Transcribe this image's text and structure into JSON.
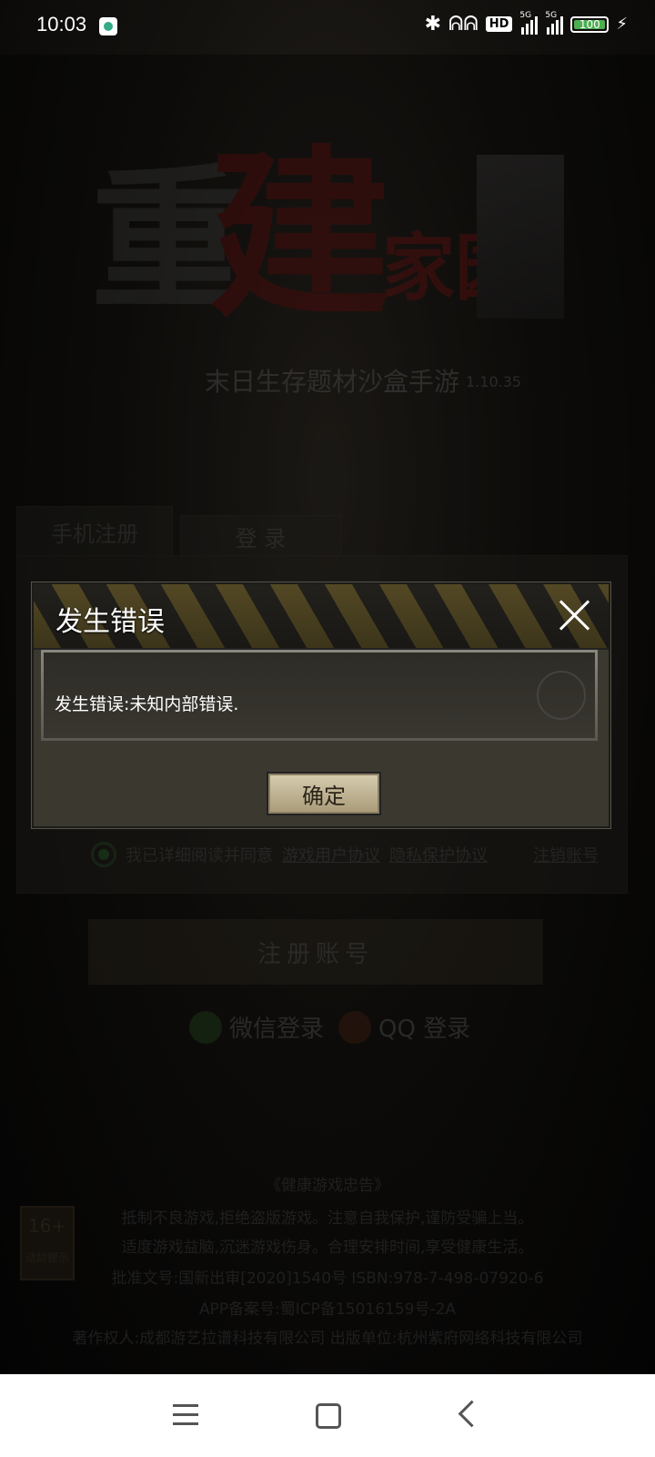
{
  "status_bar": {
    "time": "10:03",
    "network_label_1": "5G",
    "network_label_2": "5G",
    "hd_label": "HD",
    "battery": "100"
  },
  "background": {
    "logo_main": "重",
    "logo_red": "建",
    "logo_small": "家园",
    "subtitle": "末日生存题材沙盒手游",
    "version": "1.10.35",
    "tabs": [
      "手机注册",
      "登 录"
    ],
    "agree_text": "我已详细阅读并同意",
    "agree_links": [
      "游戏用户协议",
      "隐私保护协议"
    ],
    "cancel_account": "注销账号",
    "register_button": "注册账号",
    "wechat_login": "微信登录",
    "qq_login": "QQ 登录",
    "notice_title": "《健康游戏忠告》",
    "notice_lines": [
      "抵制不良游戏,拒绝盗版游戏。注意自我保护,谨防受骗上当。",
      "适度游戏益脑,沉迷游戏伤身。合理安排时间,享受健康生活。",
      "批准文号:国新出审[2020]1540号  ISBN:978-7-498-07920-6",
      "APP备案号:蜀ICP备15016159号-2A",
      "著作权人:成都游艺拉谱科技有限公司 出版单位:杭州紫府网络科技有限公司"
    ],
    "age_badge": "16+",
    "age_badge_label": "适龄提示"
  },
  "dialog": {
    "title": "发生错误",
    "message": "发生错误:未知内部错误.",
    "ok_label": "确定"
  }
}
